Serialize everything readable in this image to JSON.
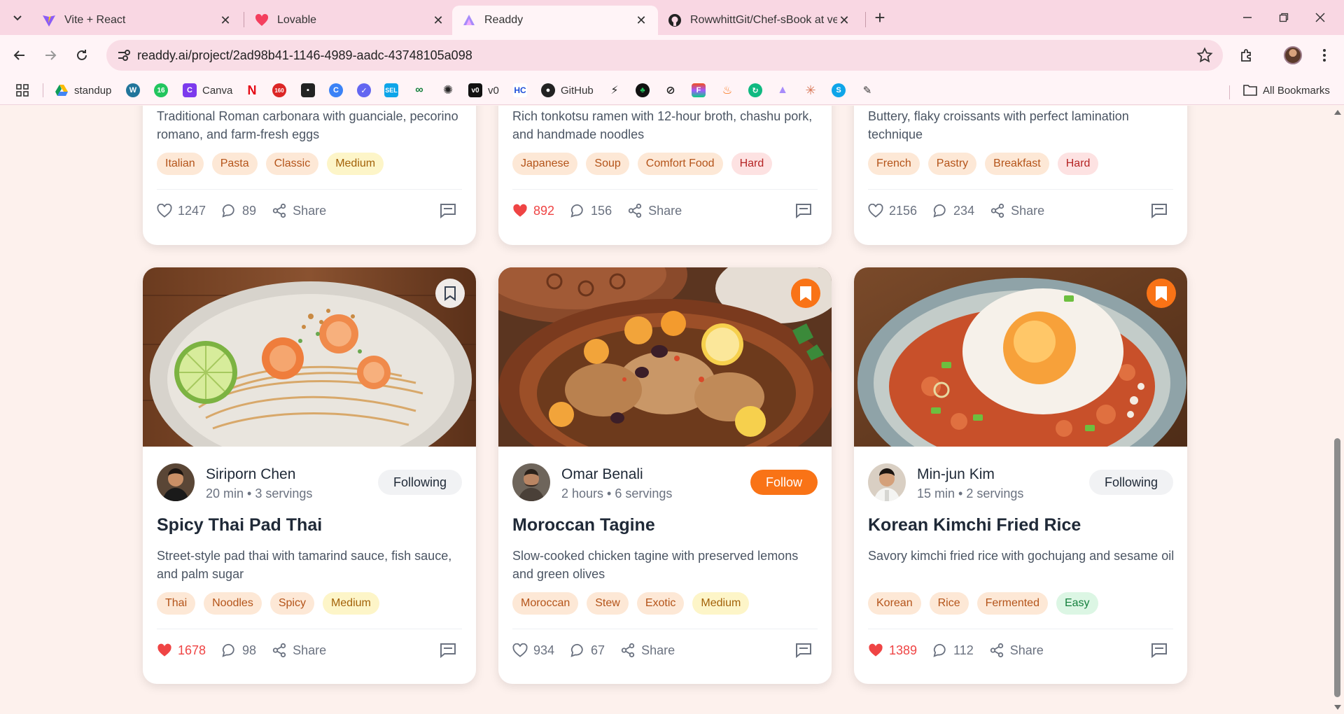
{
  "browser": {
    "tabs": [
      {
        "title": "Vite + React",
        "icon": "vite-icon"
      },
      {
        "title": "Lovable",
        "icon": "lovable-icon"
      },
      {
        "title": "Readdy",
        "icon": "readdy-icon",
        "active": true
      },
      {
        "title": "RowwhittGit/Chef-sBook at vers",
        "icon": "github-icon"
      }
    ],
    "url": "readdy.ai/project/2ad98b41-1146-4989-aadc-43748105a098",
    "bookmarks": [
      {
        "label": "standup",
        "icon": "drive-icon"
      },
      {
        "label": "",
        "icon": "wordpress-icon"
      },
      {
        "label": "",
        "icon": "sixteen-icon"
      },
      {
        "label": "Canva",
        "icon": "canva-icon"
      },
      {
        "label": "",
        "icon": "netflix-icon"
      },
      {
        "label": "",
        "icon": "counter-160-icon"
      },
      {
        "label": "",
        "icon": "bot-icon"
      },
      {
        "label": "",
        "icon": "circle-c-icon"
      },
      {
        "label": "",
        "icon": "mark-icon"
      },
      {
        "label": "",
        "icon": "sel-icon"
      },
      {
        "label": "",
        "icon": "infinity-icon"
      },
      {
        "label": "",
        "icon": "openai-icon"
      },
      {
        "label": "v0",
        "icon": "v0-icon"
      },
      {
        "label": "",
        "icon": "hc-icon"
      },
      {
        "label": "GitHub",
        "icon": "github-icon"
      },
      {
        "label": "",
        "icon": "bolt-icon"
      },
      {
        "label": "",
        "icon": "leaf-icon"
      },
      {
        "label": "",
        "icon": "ring-icon"
      },
      {
        "label": "",
        "icon": "figma-icon"
      },
      {
        "label": "",
        "icon": "flame-icon"
      },
      {
        "label": "",
        "icon": "loop-icon"
      },
      {
        "label": "",
        "icon": "readdy-icon"
      },
      {
        "label": "",
        "icon": "claude-icon"
      },
      {
        "label": "",
        "icon": "s-icon"
      },
      {
        "label": "",
        "icon": "extension-icon"
      }
    ],
    "all_bookmarks": "All Bookmarks"
  },
  "top_cards": [
    {
      "description": "Traditional Roman carbonara with guanciale, pecorino romano, and farm-fresh eggs",
      "tags": [
        {
          "label": "Italian",
          "kind": "cuisine"
        },
        {
          "label": "Pasta",
          "kind": "cuisine"
        },
        {
          "label": "Classic",
          "kind": "cuisine"
        },
        {
          "label": "Medium",
          "kind": "medium"
        }
      ],
      "likes": "1247",
      "liked": false,
      "comments": "89",
      "share": "Share"
    },
    {
      "description": "Rich tonkotsu ramen with 12-hour broth, chashu pork, and handmade noodles",
      "tags": [
        {
          "label": "Japanese",
          "kind": "cuisine"
        },
        {
          "label": "Soup",
          "kind": "cuisine"
        },
        {
          "label": "Comfort Food",
          "kind": "cuisine"
        },
        {
          "label": "Hard",
          "kind": "hard"
        }
      ],
      "likes": "892",
      "liked": true,
      "comments": "156",
      "share": "Share"
    },
    {
      "description": "Buttery, flaky croissants with perfect lamination technique",
      "tags": [
        {
          "label": "French",
          "kind": "cuisine"
        },
        {
          "label": "Pastry",
          "kind": "cuisine"
        },
        {
          "label": "Breakfast",
          "kind": "cuisine"
        },
        {
          "label": "Hard",
          "kind": "hard"
        }
      ],
      "likes": "2156",
      "liked": false,
      "comments": "234",
      "share": "Share"
    }
  ],
  "cards": [
    {
      "author": "Siriporn Chen",
      "meta": "20 min • 3 servings",
      "follow_label": "Following",
      "following": true,
      "title": "Spicy Thai Pad Thai",
      "description": "Street-style pad thai with tamarind sauce, fish sauce, and palm sugar",
      "tags": [
        {
          "label": "Thai",
          "kind": "cuisine"
        },
        {
          "label": "Noodles",
          "kind": "cuisine"
        },
        {
          "label": "Spicy",
          "kind": "cuisine"
        },
        {
          "label": "Medium",
          "kind": "medium"
        }
      ],
      "likes": "1678",
      "liked": true,
      "comments": "98",
      "share": "Share",
      "bookmarked": false
    },
    {
      "author": "Omar Benali",
      "meta": "2 hours • 6 servings",
      "follow_label": "Follow",
      "following": false,
      "title": "Moroccan Tagine",
      "description": "Slow-cooked chicken tagine with preserved lemons and green olives",
      "tags": [
        {
          "label": "Moroccan",
          "kind": "cuisine"
        },
        {
          "label": "Stew",
          "kind": "cuisine"
        },
        {
          "label": "Exotic",
          "kind": "cuisine"
        },
        {
          "label": "Medium",
          "kind": "medium"
        }
      ],
      "likes": "934",
      "liked": false,
      "comments": "67",
      "share": "Share",
      "bookmarked": true
    },
    {
      "author": "Min-jun Kim",
      "meta": "15 min • 2 servings",
      "follow_label": "Following",
      "following": true,
      "title": "Korean Kimchi Fried Rice",
      "description": "Savory kimchi fried rice with gochujang and sesame oil",
      "tags": [
        {
          "label": "Korean",
          "kind": "cuisine"
        },
        {
          "label": "Rice",
          "kind": "cuisine"
        },
        {
          "label": "Fermented",
          "kind": "cuisine"
        },
        {
          "label": "Easy",
          "kind": "easy"
        }
      ],
      "likes": "1389",
      "liked": true,
      "comments": "112",
      "share": "Share",
      "bookmarked": true
    }
  ],
  "colors": {
    "accent": "#f97316",
    "liked": "#ef4444",
    "page_bg": "#fdf1ed",
    "tab_bg": "#f9d7e3"
  }
}
